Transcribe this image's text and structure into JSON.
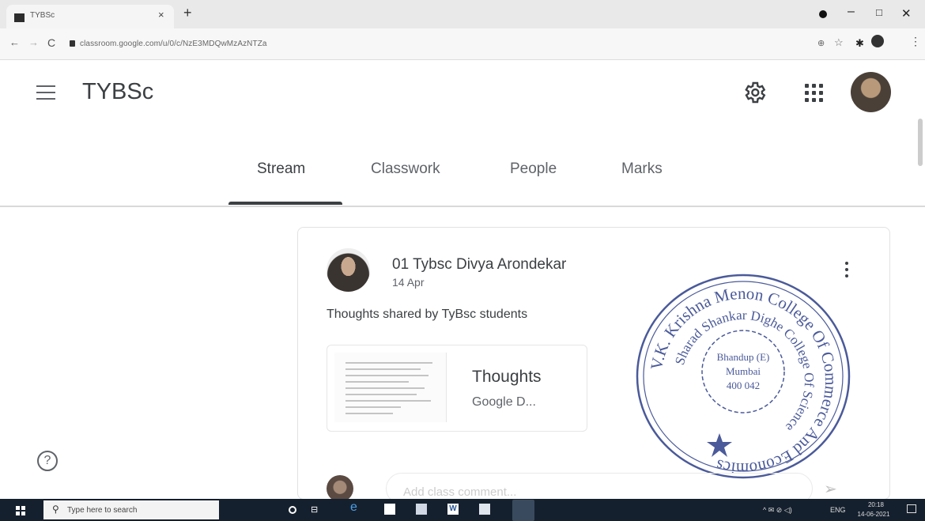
{
  "browser": {
    "tab_title": "TYBSc",
    "tab_close": "×",
    "new_tab": "+",
    "url": "classroom.google.com/u/0/c/NzE3MDQwMzAzNTZa",
    "window_min": "–",
    "window_max": "□",
    "window_close": "✕"
  },
  "header": {
    "class_name": "TYBSc"
  },
  "tabs": [
    {
      "label": "Stream",
      "active": true
    },
    {
      "label": "Classwork",
      "active": false
    },
    {
      "label": "People",
      "active": false
    },
    {
      "label": "Marks",
      "active": false
    }
  ],
  "post": {
    "author": "01 Tybsc Divya Arondekar",
    "date": "14 Apr",
    "text": "Thoughts shared by TyBsc students",
    "attachment": {
      "title": "Thoughts",
      "type": "Google D..."
    }
  },
  "stamp": {
    "outer_text": "V.K. Krishna Menon College Of Commerce And Economics",
    "inner_text": "Sharad Shankar Dighe College Of Science",
    "center_line1": "Bhandup (E)",
    "center_line2": "Mumbai",
    "center_line3": "400 042",
    "color": "#4a5a9a"
  },
  "comment": {
    "placeholder": "Add class comment..."
  },
  "help": {
    "glyph": "?"
  },
  "taskbar": {
    "search_placeholder": "Type here to search",
    "word_label": "W",
    "tray_icons": "^ ✉ ⊘ ◁)",
    "language": "ENG",
    "time": "20:18",
    "date": "14-06-2021"
  }
}
